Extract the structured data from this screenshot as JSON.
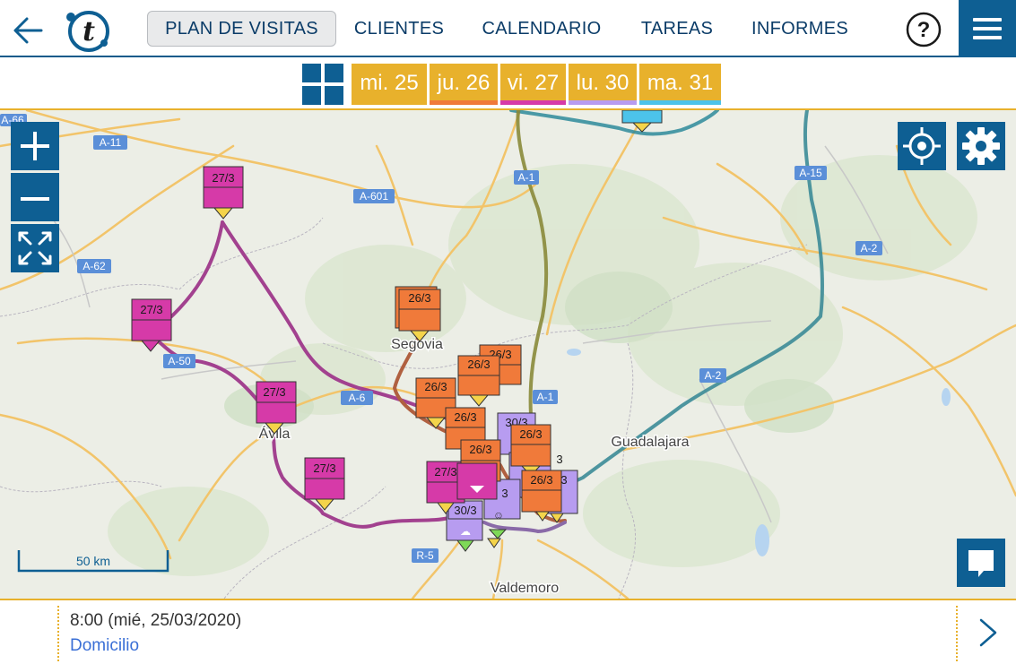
{
  "topbar": {
    "nav": [
      {
        "label": "PLAN DE VISITAS",
        "active": true
      },
      {
        "label": "CLIENTES",
        "active": false
      },
      {
        "label": "CALENDARIO",
        "active": false
      },
      {
        "label": "TAREAS",
        "active": false
      },
      {
        "label": "INFORMES",
        "active": false
      }
    ],
    "icons": {
      "back": "back-arrow-icon",
      "logo": "app-logo-t",
      "help": "help-question-icon",
      "menu": "hamburger-menu-icon"
    }
  },
  "days": [
    {
      "label": "mi. 25",
      "color": "#e8b12c"
    },
    {
      "label": "ju. 26",
      "color": "#f07a3a"
    },
    {
      "label": "vi. 27",
      "color": "#d63aa8"
    },
    {
      "label": "lu. 30",
      "color": "#b79cf0"
    },
    {
      "label": "ma. 31",
      "color": "#4cc3ea"
    }
  ],
  "map": {
    "road_labels": [
      "A-66",
      "A-11",
      "A-601",
      "A-62",
      "A-50",
      "A-6",
      "A-1",
      "A-15",
      "A-2",
      "R-5",
      "A-1",
      "A-2"
    ],
    "places": [
      "Segovia",
      "Ávila",
      "Guadalajara",
      "Valdemoro"
    ],
    "scale_label": "50 km",
    "pins": {
      "fri": "27/3",
      "thu": "26/3",
      "mon": "30/3"
    },
    "controls": {
      "zoom_in": "zoom-in-icon",
      "zoom_out": "zoom-out-icon",
      "fit": "fit-bounds-icon",
      "locate": "locate-icon",
      "settings": "gear-icon",
      "chat": "comment-icon"
    }
  },
  "footer": {
    "time": "8:00 (mié, 25/03/2020)",
    "place": "Domicilio"
  }
}
